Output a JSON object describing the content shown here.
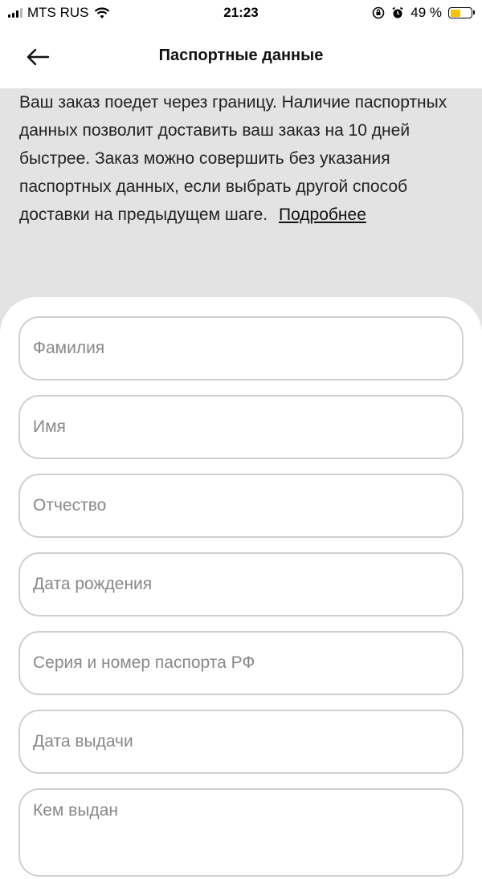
{
  "status_bar": {
    "carrier": "MTS RUS",
    "time": "21:23",
    "battery": "49 %",
    "battery_level": 0.49
  },
  "header": {
    "title": "Паспортные данные"
  },
  "info": {
    "text": "Ваш заказ поедет через границу. Наличие паспортных данных позволит доставить ваш заказ на 10 дней быстрее. Заказ можно совершить без указания паспортных данных, если выбрать другой способ доставки на предыдущем шаге.",
    "more_link": "Подробнее"
  },
  "form": {
    "last_name_placeholder": "Фамилия",
    "first_name_placeholder": "Имя",
    "middle_name_placeholder": "Отчество",
    "birth_date_placeholder": "Дата рождения",
    "passport_number_placeholder": "Серия и номер паспорта РФ",
    "issue_date_placeholder": "Дата выдачи",
    "issued_by_placeholder": "Кем выдан"
  },
  "colors": {
    "info_background": "#e3e3e3",
    "field_border": "#cfcfcf",
    "battery_fill": "#f5c400"
  }
}
